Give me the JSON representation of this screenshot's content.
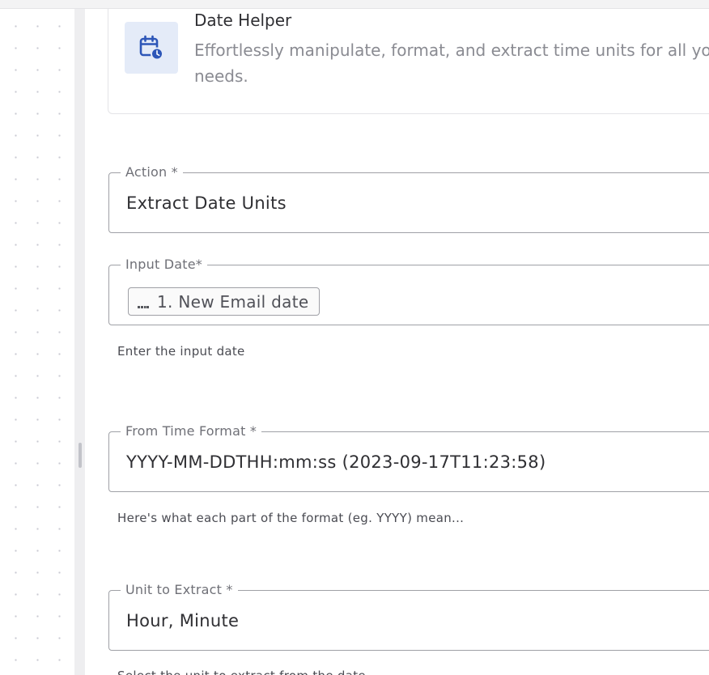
{
  "app": {
    "title": "Date Helper",
    "description": "Effortlessly manipulate, format, and extract time units for all your needs.",
    "icon": "calendar-clock-icon",
    "accent_color": "#2d56b8",
    "icon_bg_color": "#e4ebf8"
  },
  "fields": {
    "action": {
      "label": "Action *",
      "value": "Extract Date Units"
    },
    "input_date": {
      "label": "Input Date*",
      "chip_label": "1. New Email date",
      "chip_icon": "email-app-icon",
      "helper": "Enter the input date"
    },
    "from_time_format": {
      "label": "From Time Format *",
      "value": "YYYY-MM-DDTHH:mm:ss (2023-09-17T11:23:58)",
      "helper": "Here's what each part of the format (eg. YYYY) mean..."
    },
    "unit_to_extract": {
      "label": "Unit to Extract *",
      "value": "Hour, Minute",
      "helper": "Select the unit to extract from the date"
    }
  }
}
